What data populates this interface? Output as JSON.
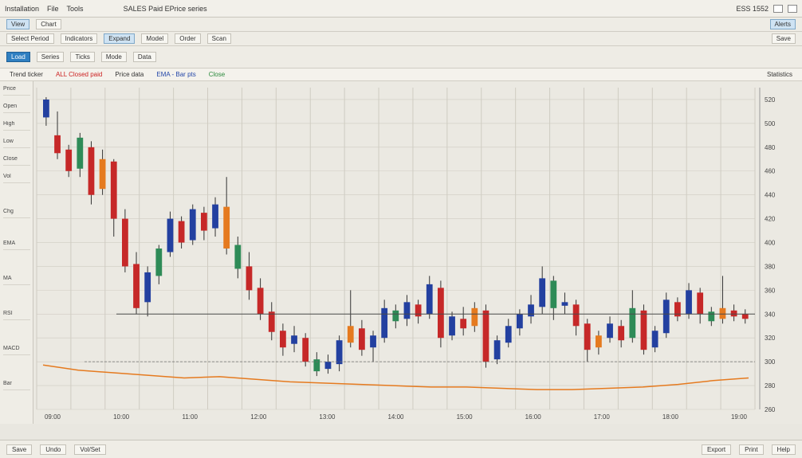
{
  "window": {
    "title": "Installation",
    "menu": [
      "File",
      "Tools"
    ],
    "status": "SALES Paid EPrice series",
    "right_info": "ESS 1552"
  },
  "toolbar1": {
    "items": [
      "View",
      "Chart",
      "Alerts"
    ]
  },
  "toolbar2": {
    "items": [
      "Select Period",
      "Indicators",
      "Expand",
      "Model",
      "Order",
      "Scan",
      "Save"
    ]
  },
  "toolbar3": {
    "active_button": "Load",
    "items": [
      "Series",
      "Ticks",
      "Mode",
      "Data"
    ]
  },
  "legend": {
    "left": "Trend ticker",
    "red": "ALL Closed paid",
    "mid": "Price data",
    "blue": "EMA - Bar pts",
    "green": "Close",
    "right": "Statistics"
  },
  "left_panel": {
    "items": [
      "Price",
      "Open",
      "High",
      "Low",
      "Close",
      "Vol",
      "Chg",
      "EMA",
      "MA",
      "RSI",
      "MACD",
      "Bar"
    ]
  },
  "colors": {
    "up": "#c62828",
    "down": "#2340a0",
    "neutral": "#2e8b57",
    "accent": "#e57a1f",
    "grid": "#cfccc2",
    "bg": "#ebe9e2"
  },
  "chart_data": {
    "type": "candlestick",
    "title": "",
    "y_axis_ticks": [
      "520",
      "500",
      "480",
      "460",
      "440",
      "420",
      "400",
      "380",
      "360",
      "340",
      "320",
      "300",
      "280",
      "260"
    ],
    "ylim": [
      260,
      530
    ],
    "x_tick_labels": [
      "09:00",
      "10:00",
      "11:00",
      "12:00",
      "13:00",
      "14:00",
      "15:00",
      "16:00",
      "17:00",
      "18:00",
      "19:00"
    ],
    "candles": [
      [
        505,
        520,
        498,
        522
      ],
      [
        490,
        475,
        470,
        510
      ],
      [
        478,
        460,
        455,
        482
      ],
      [
        462,
        488,
        455,
        492
      ],
      [
        480,
        440,
        432,
        485
      ],
      [
        445,
        470,
        440,
        478
      ],
      [
        468,
        420,
        405,
        470
      ],
      [
        420,
        380,
        375,
        428
      ],
      [
        382,
        345,
        340,
        392
      ],
      [
        350,
        375,
        338,
        380
      ],
      [
        372,
        395,
        365,
        398
      ],
      [
        392,
        420,
        388,
        426
      ],
      [
        418,
        400,
        395,
        422
      ],
      [
        402,
        428,
        398,
        432
      ],
      [
        425,
        410,
        402,
        430
      ],
      [
        412,
        432,
        405,
        438
      ],
      [
        430,
        395,
        390,
        455
      ],
      [
        398,
        378,
        370,
        405
      ],
      [
        380,
        360,
        352,
        392
      ],
      [
        362,
        340,
        335,
        370
      ],
      [
        342,
        325,
        318,
        350
      ],
      [
        326,
        312,
        305,
        332
      ],
      [
        315,
        322,
        308,
        330
      ],
      [
        320,
        300,
        296,
        324
      ],
      [
        302,
        292,
        288,
        308
      ],
      [
        294,
        300,
        290,
        306
      ],
      [
        298,
        318,
        292,
        322
      ],
      [
        316,
        330,
        312,
        360
      ],
      [
        328,
        310,
        305,
        335
      ],
      [
        312,
        322,
        300,
        326
      ],
      [
        320,
        345,
        316,
        352
      ],
      [
        343,
        334,
        328,
        348
      ],
      [
        336,
        350,
        330,
        356
      ],
      [
        348,
        338,
        332,
        352
      ],
      [
        340,
        365,
        336,
        372
      ],
      [
        362,
        320,
        312,
        368
      ],
      [
        322,
        338,
        318,
        342
      ],
      [
        336,
        328,
        322,
        346
      ],
      [
        330,
        345,
        325,
        350
      ],
      [
        343,
        300,
        295,
        348
      ],
      [
        302,
        318,
        298,
        322
      ],
      [
        316,
        330,
        312,
        336
      ],
      [
        328,
        340,
        322,
        344
      ],
      [
        338,
        348,
        332,
        356
      ],
      [
        346,
        370,
        340,
        380
      ],
      [
        368,
        345,
        335,
        372
      ],
      [
        347,
        350,
        340,
        358
      ],
      [
        348,
        330,
        322,
        352
      ],
      [
        332,
        310,
        300,
        336
      ],
      [
        312,
        322,
        306,
        326
      ],
      [
        320,
        332,
        316,
        338
      ],
      [
        330,
        318,
        312,
        335
      ],
      [
        320,
        345,
        316,
        360
      ],
      [
        343,
        310,
        306,
        348
      ],
      [
        312,
        326,
        308,
        330
      ],
      [
        324,
        352,
        320,
        358
      ],
      [
        350,
        338,
        334,
        354
      ],
      [
        340,
        360,
        336,
        366
      ],
      [
        358,
        340,
        332,
        362
      ],
      [
        342,
        334,
        330,
        346
      ],
      [
        336,
        345,
        332,
        372
      ],
      [
        343,
        338,
        334,
        348
      ],
      [
        340,
        336,
        332,
        344
      ]
    ],
    "line_series": [
      {
        "name": "",
        "color": "#e57a1f",
        "values": [
          300,
          296,
          294,
          292,
          290,
          291,
          289,
          287,
          286,
          285,
          284,
          283,
          283,
          282,
          281,
          281,
          282,
          283,
          285,
          288,
          290
        ]
      }
    ]
  },
  "footer": {
    "tabs": [
      "Save",
      "Undo",
      "Vol/Set"
    ],
    "right": [
      "Export",
      "Print",
      "Help"
    ]
  }
}
